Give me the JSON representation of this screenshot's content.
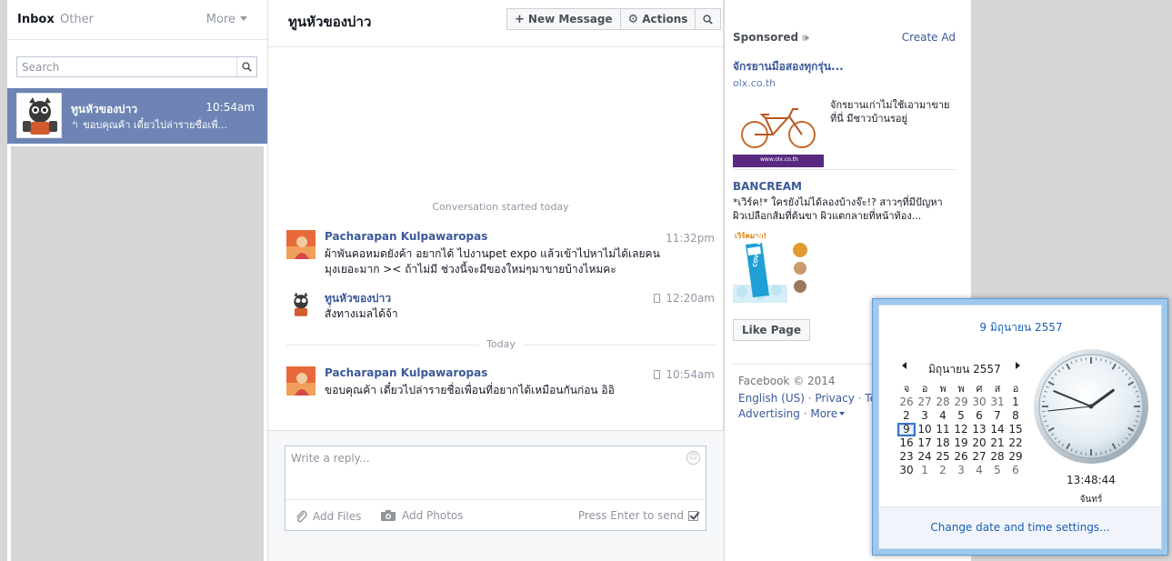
{
  "inbox": {
    "tab_inbox": "Inbox",
    "tab_other": "Other",
    "more": "More",
    "search_placeholder": "Search",
    "thread": {
      "name": "ทูนหัวของบ่าว",
      "time": "10:54am",
      "snippet": "ขอบคุณค้า เดี๋ยวไปล่ารายชื่อเพื่..."
    }
  },
  "conversation": {
    "title": "ทูนหัวของบ่าว",
    "toolbar": {
      "new_message": "New Message",
      "actions": "Actions"
    },
    "started_label": "Conversation started today",
    "today_label": "Today",
    "messages": [
      {
        "sender": "Pacharapan Kulpawaropas",
        "time": "11:32pm",
        "line1": "ผ้าพันคอหมดยังค้า อยากได้ ไปงานpet expo แล้วเข้าไปหาไม่ได้เลยคน",
        "line2": "มุงเยอะมาก >< ถ้าไม่มี ช่วงนี้จะมีของใหม่ๆมาขายบ้างไหมคะ"
      },
      {
        "sender": "ทูนหัวของบ่าว",
        "time": "12:20am",
        "line1": "สั่งทางเมลได้จ้า"
      },
      {
        "sender": "Pacharapan Kulpawaropas",
        "time": "10:54am",
        "line1": "ขอบคุณค้า เดี๋ยวไปล่ารายชื่อเพื่อนที่อยากได้เหมือนกันก่อน อิอิ"
      }
    ],
    "composer": {
      "placeholder": "Write a reply...",
      "add_files": "Add Files",
      "add_photos": "Add Photos",
      "press_enter": "Press Enter to send"
    }
  },
  "sidebar": {
    "sponsored": "Sponsored",
    "create_ad": "Create Ad",
    "ads": [
      {
        "title": "จักรยานมือสองทุกรุ่น...",
        "domain": "olx.co.th",
        "text": "จักรยานเก่าไม่ใช้เอามาขาย ที่นี่ มีชาวบ้านรอยู่",
        "image_caption": "www.olx.co.th"
      },
      {
        "title": "BANCREAM",
        "text": "*เวิร์ค!* ใครยังไม่ได้ลองบ้างจ๊ะ!? สาวๆที่มีปัญหา ผิวเปลือกส้มที่ต้นขา ผิวแตกลายที่หน้าท้อง...",
        "badge_text": "เวิร์คมาก!",
        "product_text": "COVER GEL"
      }
    ],
    "like_page": "Like Page",
    "footer": {
      "copyright": "Facebook © 2014",
      "english": "English (US)",
      "privacy": "Privacy",
      "terms": "Ter",
      "advertising": "Advertising",
      "more": "More"
    }
  },
  "clock": {
    "long_date": "9 มิถุนายน 2557",
    "month_label": "มิถุนายน 2557",
    "weekday_headers": [
      "จ",
      "อ",
      "พ",
      "พ",
      "ศ",
      "ส",
      "อ"
    ],
    "weeks": [
      [
        "26",
        "27",
        "28",
        "29",
        "30",
        "31",
        "1"
      ],
      [
        "2",
        "3",
        "4",
        "5",
        "6",
        "7",
        "8"
      ],
      [
        "9",
        "10",
        "11",
        "12",
        "13",
        "14",
        "15"
      ],
      [
        "16",
        "17",
        "18",
        "19",
        "20",
        "21",
        "22"
      ],
      [
        "23",
        "24",
        "25",
        "26",
        "27",
        "28",
        "29"
      ],
      [
        "30",
        "1",
        "2",
        "3",
        "4",
        "5",
        "6"
      ]
    ],
    "today_day": "9",
    "time": "13:48:44",
    "weekday_name": "จันทร์",
    "settings_link": "Change date and time settings...",
    "hands": {
      "hour": 13,
      "minute": 48,
      "second": 44
    }
  },
  "colors": {
    "fb_blue": "#3b5998",
    "selected_thread": "#6d84b4",
    "win_accent": "#1a5fb4"
  }
}
